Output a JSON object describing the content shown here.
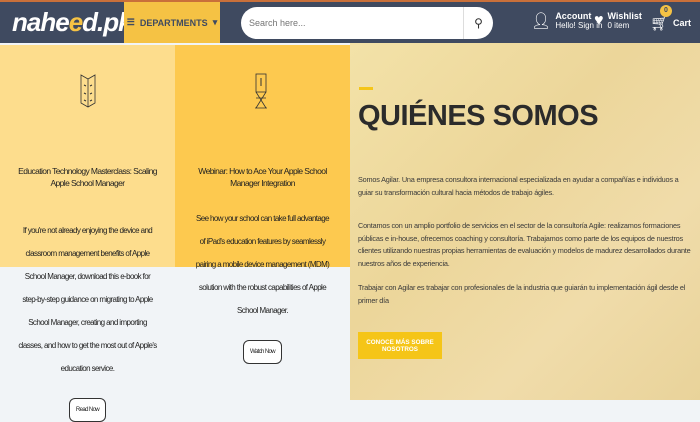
{
  "header": {
    "logo": "naheed.pk",
    "departments": "DEPARTMENTS",
    "search_placeholder": "Search here...",
    "account_title": "Account",
    "account_sub": "Hello! Sign in",
    "wishlist_title": "Wishlist",
    "wishlist_sub": "0 item",
    "cart_count": "0",
    "cart": "Cart"
  },
  "cards": [
    {
      "title": "Education Technology Masterclass: Scaling Apple School Manager",
      "body": "If you're not already enjoying the device and classroom management benefits of Apple School Manager, download this e-book for step-by-step guidance on migrating to Apple School Manager, creating and importing classes, and how to get the most out of Apple's education service.",
      "button": "Read Now"
    },
    {
      "title": "Webinar: How to Ace Your Apple School Manager Integration",
      "body": "See how your school can take full advantage of iPad's education features by seamlessly pairing a mobile device management (MDM) solution with the robust capabilities of Apple School Manager.",
      "button": "Watch Now"
    }
  ],
  "about": {
    "heading": "QUIÉNES SOMOS",
    "p1": "Somos Agilar. Una empresa consultora internacional especializada en ayudar a compañías e individuos a guiar su transformación cultural hacia métodos de trabajo ágiles.",
    "p2": "Contamos con un amplio portfolio de servicios en el sector de la consultoría Agile: realizamos formaciones públicas e in-house, ofrecemos coaching y consultoría. Trabajamos como parte de los equipos de nuestros clientes utilizando nuestras propias herramientas de evaluación y modelos de madurez desarrollados durante nuestros años de experiencia.",
    "p3": "Trabajar con Agilar es trabajar con profesionales de la industria que guiarán tu implementación ágil desde el primer día",
    "button": "CONOCE MÁS SOBRE NOSOTROS"
  },
  "colors": {
    "header": "#3f4a60",
    "accent": "#f5c244",
    "button": "#f5c518"
  }
}
